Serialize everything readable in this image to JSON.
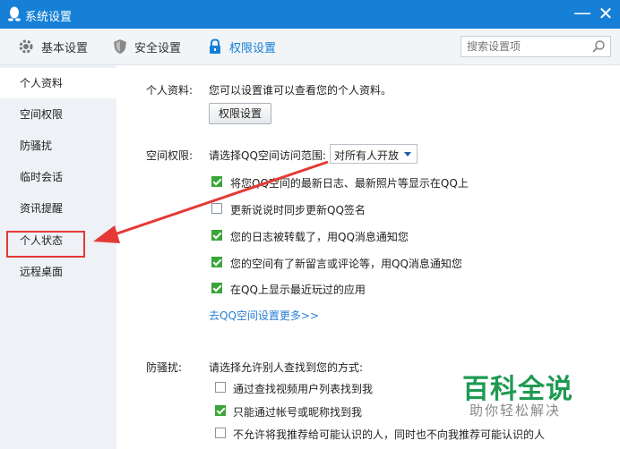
{
  "window": {
    "title": "系统设置",
    "minimize": "—",
    "close": "✕"
  },
  "tabs": [
    {
      "label": "基本设置",
      "icon": "gear-icon"
    },
    {
      "label": "安全设置",
      "icon": "shield-icon"
    },
    {
      "label": "权限设置",
      "icon": "lock-icon",
      "active": true
    }
  ],
  "search": {
    "placeholder": "搜索设置项"
  },
  "sidebar": {
    "items": [
      {
        "label": "个人资料",
        "active": true
      },
      {
        "label": "空间权限"
      },
      {
        "label": "防骚扰"
      },
      {
        "label": "临时会话"
      },
      {
        "label": "资讯提醒"
      },
      {
        "label": "个人状态",
        "highlighted": true
      },
      {
        "label": "远程桌面"
      }
    ]
  },
  "profile": {
    "label": "个人资料:",
    "description": "您可以设置谁可以查看您的个人资料。",
    "button": "权限设置"
  },
  "space": {
    "label": "空间权限:",
    "range_label": "请选择QQ空间访问范围:",
    "range_value": "对所有人开放",
    "options": [
      {
        "label": "将您QQ空间的最新日志、最新照片等显示在QQ上",
        "checked": true
      },
      {
        "label": "更新说说时同步更新QQ签名",
        "checked": false
      },
      {
        "label": "您的日志被转载了，用QQ消息通知您",
        "checked": true
      },
      {
        "label": "您的空间有了新留言或评论等，用QQ消息通知您",
        "checked": true
      },
      {
        "label": "在QQ上显示最近玩过的应用",
        "checked": true
      }
    ],
    "more_link": "去QQ空间设置更多>>"
  },
  "harass": {
    "label": "防骚扰:",
    "description": "请选择允许别人查找到您的方式:",
    "options": [
      {
        "label": "通过查找视频用户列表找到我",
        "checked": false
      },
      {
        "label": "只能通过帐号或昵称找到我",
        "checked": true
      },
      {
        "label": "不允许将我推荐给可能认识的人，同时也不向我推荐可能认识的人",
        "checked": false
      }
    ]
  },
  "watermark": {
    "title": "百科全说",
    "subtitle": "助你轻松解决"
  },
  "colors": {
    "titlebar": "#1680d6",
    "accent": "#1680d6",
    "check": "#3aa53a",
    "annotation": "#e53935",
    "watermark": "#1f9a52"
  }
}
